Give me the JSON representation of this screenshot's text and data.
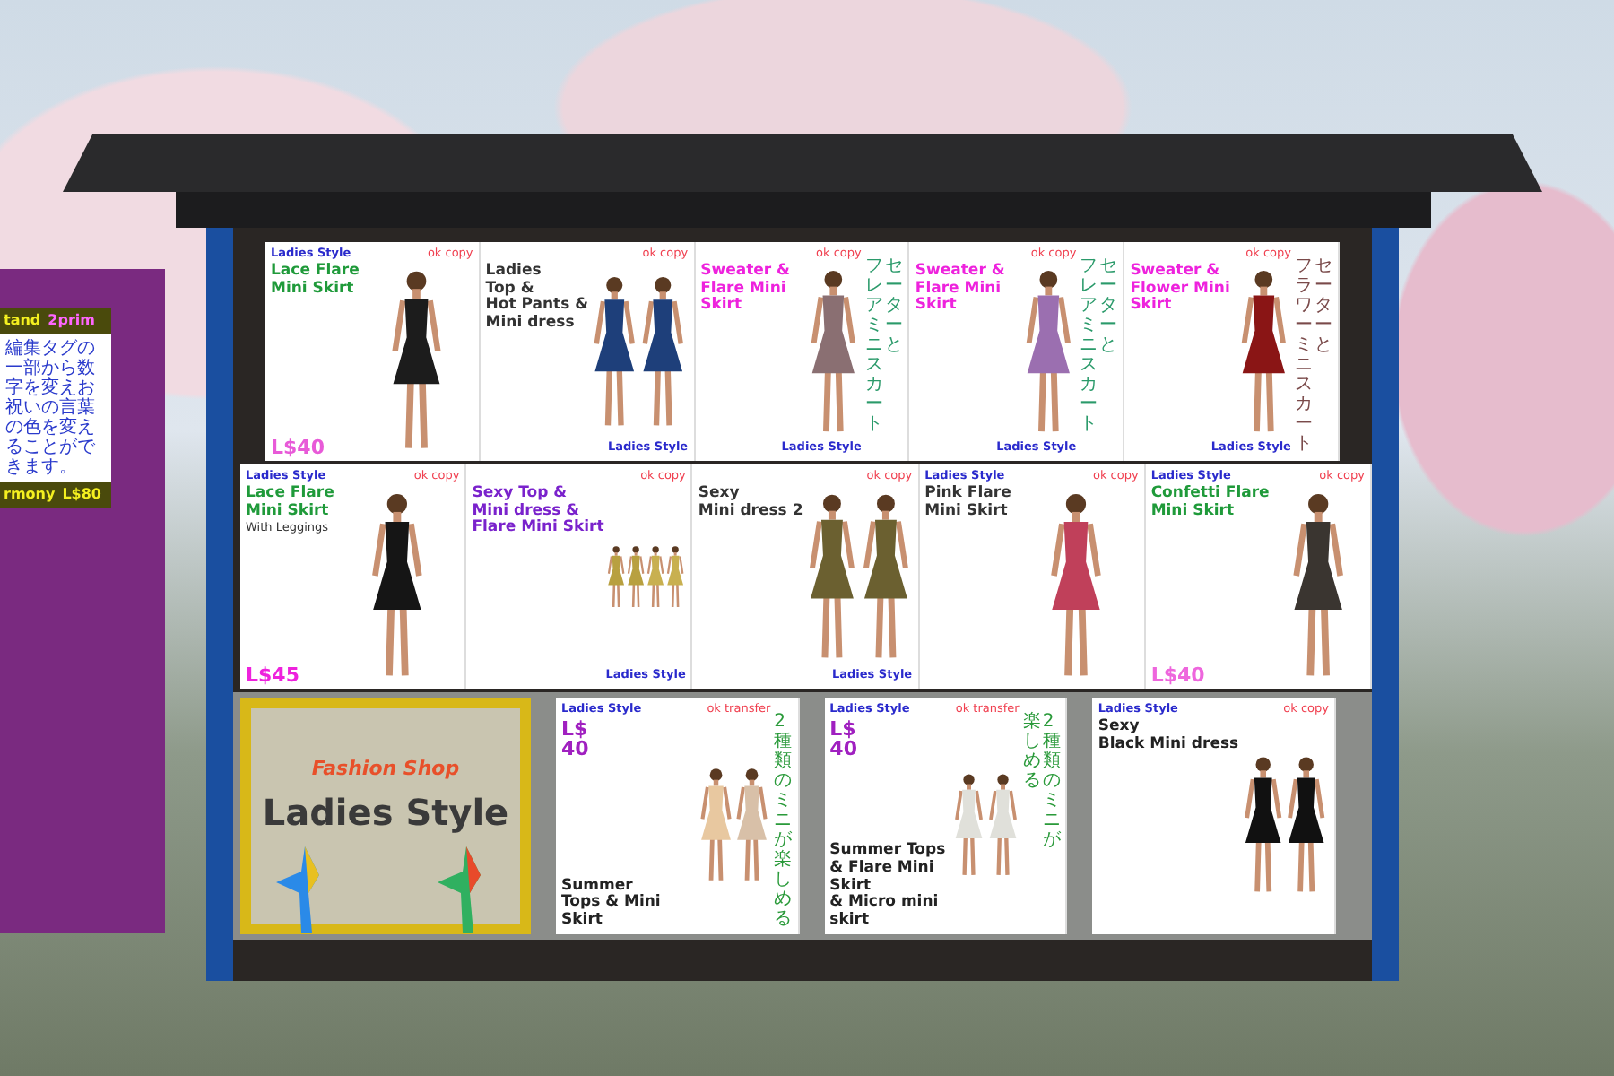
{
  "side_sign": {
    "header": "tand",
    "perms": "2prim",
    "note": "編集タグの一部から数字を変えお祝いの言葉の色を変えることができます。",
    "footer": "rmony",
    "price": "L$80"
  },
  "stall": {
    "rows": [
      {
        "posters": [
          {
            "kind": "poster",
            "brand_top": "Ladies Style",
            "perms": "ok copy",
            "title": {
              "text": "Lace Flare\nMini Skirt",
              "color": "#1f9a3a"
            },
            "price": {
              "text": "L$40",
              "color": "#e85ad8"
            },
            "models": [
              {
                "color": "#1c1c1c"
              }
            ]
          },
          {
            "kind": "poster",
            "perms": "ok copy",
            "title": {
              "text": "Ladies\nTop &\nHot Pants &\nMini dress",
              "color": "#333333"
            },
            "brand_bottom": "Ladies Style",
            "models": [
              {
                "color": "#1e3f7a"
              },
              {
                "color": "#1e3f7a"
              }
            ]
          },
          {
            "kind": "poster",
            "perms": "ok copy",
            "title": {
              "text": "Sweater &\nFlare Mini Skirt",
              "color": "#ee22dd"
            },
            "jp": [
              {
                "text": "フレアミニスカート",
                "color": "#2a9a6a"
              },
              {
                "text": "セーターと",
                "color": "#2a9a6a"
              }
            ],
            "brand_bottom": "Ladies Style",
            "models": [
              {
                "color": "#8a6f72"
              }
            ]
          },
          {
            "kind": "poster",
            "perms": "ok copy",
            "title": {
              "text": "Sweater &\nFlare Mini Skirt",
              "color": "#ee22dd"
            },
            "jp": [
              {
                "text": "フレアミニスカート",
                "color": "#2a9a6a"
              },
              {
                "text": "セーターと",
                "color": "#2a9a6a"
              }
            ],
            "brand_bottom": "Ladies Style",
            "models": [
              {
                "color": "#9b6fb0"
              }
            ]
          },
          {
            "kind": "poster",
            "perms": "ok copy",
            "title": {
              "text": "Sweater &\nFlower Mini Skirt",
              "color": "#ee22dd"
            },
            "jp": [
              {
                "text": "フラワーミニスカート",
                "color": "#7a4a4a"
              },
              {
                "text": "セーターと",
                "color": "#7a4a4a"
              }
            ],
            "brand_bottom": "Ladies Style",
            "models": [
              {
                "color": "#8a1515"
              }
            ]
          }
        ]
      },
      {
        "posters": [
          {
            "kind": "poster",
            "brand_top": "Ladies Style",
            "perms": "ok copy",
            "title": {
              "text": "Lace Flare\nMini Skirt",
              "color": "#1f9a3a"
            },
            "subtitle": "With Leggings",
            "price": {
              "text": "L$45",
              "color": "#ee22dd"
            },
            "models": [
              {
                "color": "#151515"
              }
            ]
          },
          {
            "kind": "poster",
            "perms": "ok copy",
            "title": {
              "text": "Sexy Top &\nMini dress &\nFlare Mini Skirt",
              "color": "#7a22cc"
            },
            "brand_bottom": "Ladies Style",
            "models": [
              {
                "color": "#b8a040"
              },
              {
                "color": "#b8a040"
              },
              {
                "color": "#c8b050"
              },
              {
                "color": "#c8b050"
              }
            ]
          },
          {
            "kind": "poster",
            "perms": "ok copy",
            "title": {
              "text": "Sexy\nMini dress 2",
              "color": "#333333"
            },
            "brand_bottom": "Ladies Style",
            "models": [
              {
                "color": "#6b6030"
              },
              {
                "color": "#6b6030"
              }
            ]
          },
          {
            "kind": "poster",
            "brand_top": "Ladies Style",
            "perms": "ok copy",
            "title": {
              "text": "Pink Flare\nMini Skirt",
              "color": "#333333"
            },
            "models": [
              {
                "color": "#c0405a"
              }
            ]
          },
          {
            "kind": "poster",
            "brand_top": "Ladies Style",
            "perms": "ok copy",
            "title": {
              "text": "Confetti Flare\nMini Skirt",
              "color": "#1f9a3a"
            },
            "price": {
              "text": "L$40",
              "color": "#ee66dd"
            },
            "models": [
              {
                "color": "#3a3530"
              }
            ]
          }
        ]
      },
      {
        "posters": [
          {
            "kind": "logo",
            "tagline": "Fashion Shop",
            "name": "Ladies Style"
          },
          {
            "kind": "poster",
            "brand_top": "Ladies Style",
            "perms": "ok transfer",
            "price": {
              "text": "L$\n40",
              "color": "#a020c0"
            },
            "jp": [
              {
                "text": "2種類のミニが楽しめる",
                "color": "#2a9a3a"
              }
            ],
            "title": {
              "text": "Summer\nTops & Mini Skirt",
              "color": "#222222"
            },
            "models": [
              {
                "color": "#e8c8a0"
              },
              {
                "color": "#d8c0a8"
              }
            ]
          },
          {
            "kind": "poster",
            "brand_top": "Ladies Style",
            "perms": "ok transfer",
            "price": {
              "text": "L$\n40",
              "color": "#a020c0"
            },
            "jp": [
              {
                "text": "楽しめる",
                "color": "#2a9a3a"
              },
              {
                "text": "2種類のミニが",
                "color": "#2a9a3a"
              }
            ],
            "title": {
              "text": "Summer Tops\n& Flare Mini Skirt\n& Micro mini skirt",
              "color": "#222222"
            },
            "models": [
              {
                "color": "#e0e0da"
              },
              {
                "color": "#e0e0da"
              }
            ]
          },
          {
            "kind": "poster",
            "brand_top": "Ladies Style",
            "perms": "ok copy",
            "title": {
              "text": "Sexy\nBlack Mini dress",
              "color": "#222222"
            },
            "models": [
              {
                "color": "#111111"
              },
              {
                "color": "#111111"
              }
            ]
          }
        ]
      }
    ]
  }
}
